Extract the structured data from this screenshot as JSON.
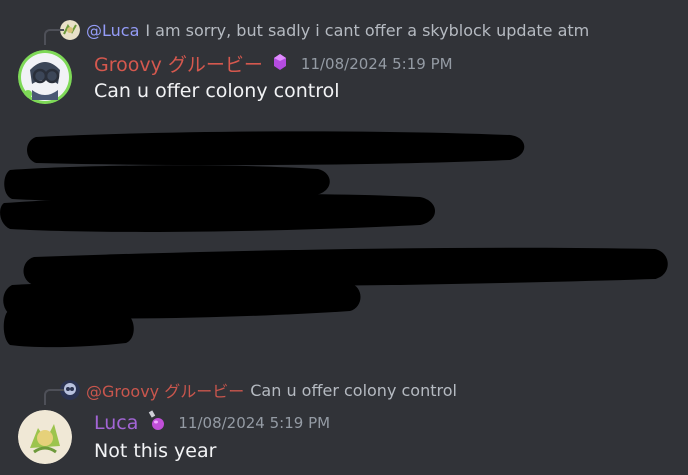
{
  "message1": {
    "reply": {
      "mention": "@Luca",
      "text": "I am sorry, but sadly i cant offer a skyblock update atm"
    },
    "author": "Groovy グルービー",
    "author_badge_icon": "purple-gem-icon",
    "timestamp": "11/08/2024 5:19 PM",
    "content": "Can u offer colony control"
  },
  "message2": {
    "reply": {
      "mention": "@Groovy グルービー",
      "text": "Can u offer colony control"
    },
    "author": "Luca",
    "author_badge_icon": "potion-icon",
    "timestamp": "11/08/2024 5:19 PM",
    "content": "Not this year"
  },
  "colors": {
    "background": "#313338",
    "author_red": "#d5584e",
    "author_purple": "#a365d6",
    "mention": "#949cf7",
    "timestamp": "#949ba4"
  }
}
